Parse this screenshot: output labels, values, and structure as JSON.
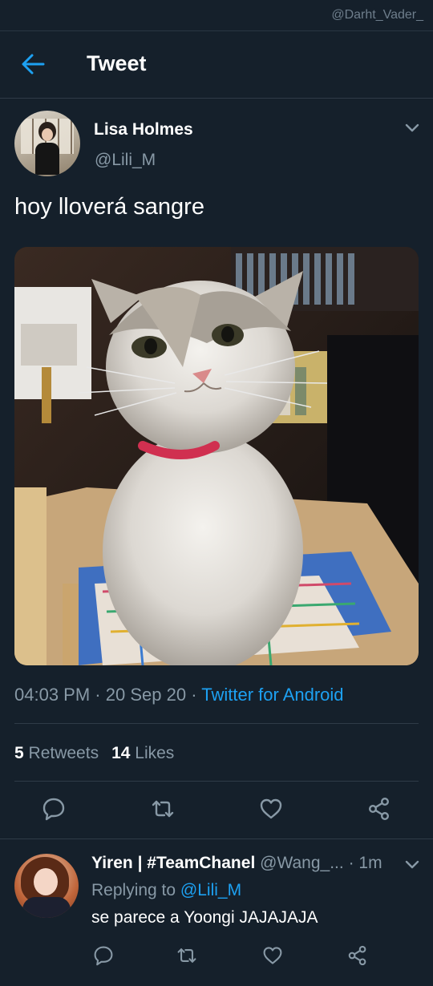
{
  "watermark": "@Darht_Vader_",
  "header": {
    "title": "Tweet",
    "back_icon": "arrow-left-icon"
  },
  "tweet": {
    "author_name": "Lisa Holmes",
    "author_handle": "@Lili_M",
    "text": "hoy lloverá sangre",
    "time": "04:03 PM",
    "date": "20 Sep 20",
    "separator": "·",
    "client": "Twitter for Android",
    "retweets_count": "5",
    "retweets_label": "Retweets",
    "likes_count": "14",
    "likes_label": "Likes",
    "actions": [
      "reply-icon",
      "retweet-icon",
      "like-icon",
      "share-icon"
    ]
  },
  "reply": {
    "name": "Yiren | #TeamChanel",
    "handle": "@Wang_...",
    "age": "1m",
    "replying_prefix": "Replying to",
    "replying_to": "@Lili_M",
    "text": "se parece a Yoongi JAJAJAJA"
  },
  "colors": {
    "background": "#15202b",
    "accent": "#1da1f2",
    "secondary_text": "#8899a6",
    "border": "#2f3b47"
  }
}
